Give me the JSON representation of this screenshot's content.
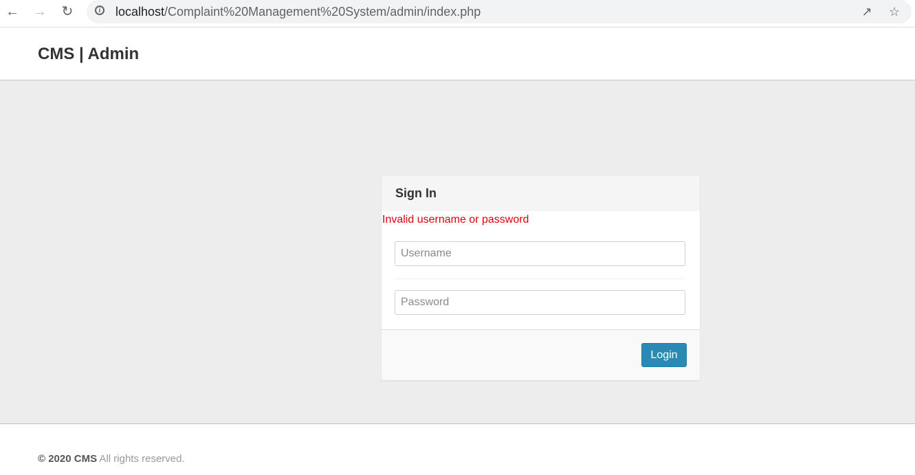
{
  "browser": {
    "url_host": "localhost",
    "url_path": "/Complaint%20Management%20System/admin/index.php"
  },
  "header": {
    "brand": "CMS | Admin"
  },
  "login": {
    "title": "Sign In",
    "error": "Invalid username or password",
    "username_placeholder": "Username",
    "username_value": "",
    "password_placeholder": "Password",
    "password_value": "",
    "button_label": "Login"
  },
  "footer": {
    "copyright_strong": "© 2020 CMS",
    "copyright_rest": " All rights reserved."
  },
  "colors": {
    "accent": "#2a8ab3",
    "error": "#e0000a",
    "background": "#ededed"
  }
}
